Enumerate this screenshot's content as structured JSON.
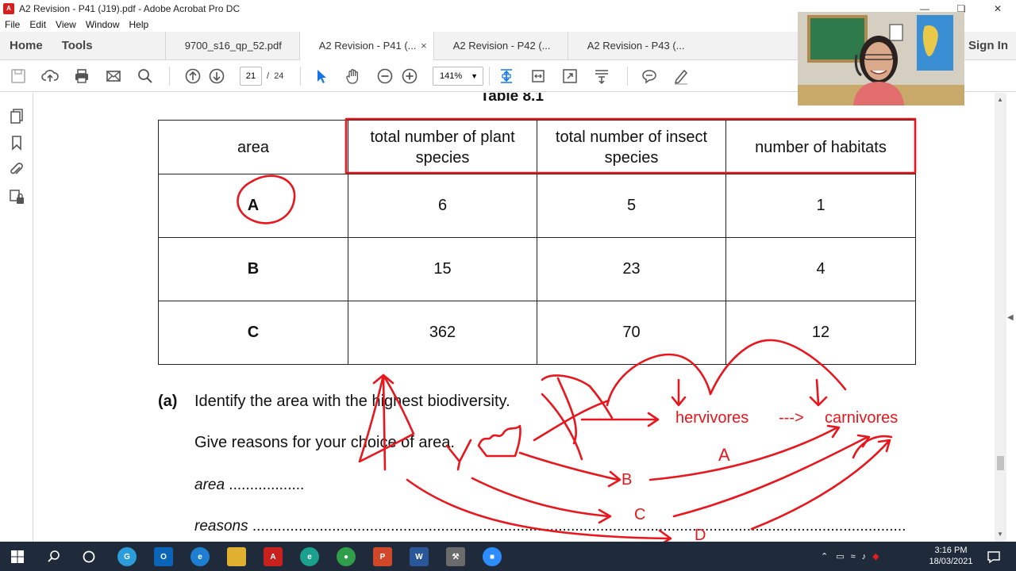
{
  "window": {
    "title": "A2 Revision - P41 (J19).pdf - Adobe Acrobat Pro DC",
    "app_icon": "acrobat-icon",
    "controls": [
      "minimize",
      "restore",
      "close"
    ]
  },
  "menu": [
    "File",
    "Edit",
    "View",
    "Window",
    "Help"
  ],
  "tabs": {
    "home": "Home",
    "tools": "Tools",
    "documents": [
      {
        "label": "9700_s16_qp_52.pdf",
        "active": false
      },
      {
        "label": "A2 Revision - P41 (...",
        "active": true,
        "close": "×"
      },
      {
        "label": "A2 Revision - P42 (...",
        "active": false
      },
      {
        "label": "A2 Revision - P43 (...",
        "active": false
      }
    ],
    "sign_in": "Sign In"
  },
  "toolbar": {
    "page_current": "21",
    "page_separator": "/",
    "page_total": "24",
    "zoom": "141%",
    "zoom_caret": "▼"
  },
  "document": {
    "table_caption": "Table 8.1",
    "table": {
      "headers": [
        "area",
        "total number of plant species",
        "total number of insect species",
        "number of habitats"
      ],
      "rows": [
        {
          "area": "A",
          "plant": "6",
          "insect": "5",
          "habitats": "1"
        },
        {
          "area": "B",
          "plant": "15",
          "insect": "23",
          "habitats": "4"
        },
        {
          "area": "C",
          "plant": "362",
          "insect": "70",
          "habitats": "12"
        }
      ]
    },
    "question": {
      "part": "(a)",
      "line1": "Identify the area with the highest biodiversity.",
      "line2": "Give reasons for your choice of area.",
      "area_label": "area",
      "area_dots": " ..................",
      "reasons_label": "reasons",
      "reasons_dots": " ............................................................................................................................................................"
    },
    "annotations": {
      "text1": "hervivores",
      "arrow_text": "--->",
      "text2": "carnivores",
      "letter_a": "A",
      "letter_b": "B",
      "letter_c": "C",
      "letter_d": "D",
      "color": "#e8161d"
    }
  },
  "taskbar": {
    "clock_time": "3:16 PM",
    "clock_date": "18/03/2021",
    "bg_color": "#1f2b3a"
  }
}
